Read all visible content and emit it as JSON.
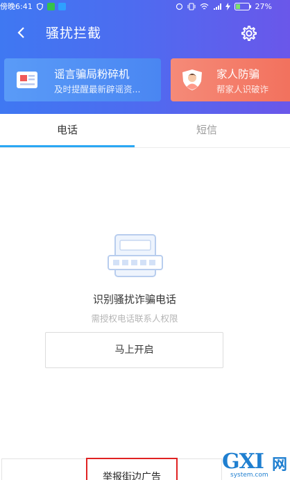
{
  "status_bar": {
    "time": "傍晚6:41",
    "battery": "27%"
  },
  "header": {
    "title": "骚扰拦截"
  },
  "cards": [
    {
      "title": "谣言骗局粉碎机",
      "subtitle": "及时提醒最新辟谣资..."
    },
    {
      "title": "家人防骗",
      "subtitle": "帮家人识破诈"
    }
  ],
  "tabs": [
    {
      "label": "电话",
      "active": true
    },
    {
      "label": "短信",
      "active": false
    }
  ],
  "empty_state": {
    "title": "识别骚扰诈骗电话",
    "hint": "需授权电话联系人权限",
    "button": "马上开启"
  },
  "bottom": {
    "report_button": "举报街边广告"
  },
  "watermark": {
    "main": "GXI",
    "cn": "网",
    "sub": "system.com"
  },
  "colors": {
    "header_start": "#3f78f2",
    "header_end": "#6a57ea",
    "tab_indicator": "#2aa7f4",
    "highlight_border": "#e02222"
  }
}
